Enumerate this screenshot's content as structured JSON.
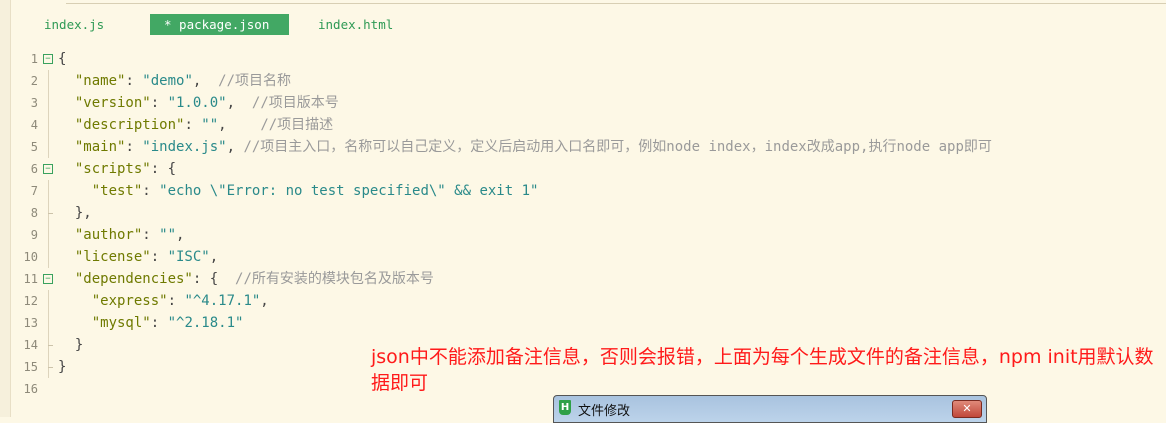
{
  "tabs": [
    {
      "label": "index.js",
      "active": false
    },
    {
      "label": "* package.json",
      "active": true
    },
    {
      "label": "index.html",
      "active": false
    }
  ],
  "lines": [
    {
      "n": "1",
      "fold": "open",
      "tokens": [
        {
          "t": "p",
          "v": "{"
        }
      ]
    },
    {
      "n": "2",
      "tokens": [
        {
          "t": "p",
          "v": "  "
        },
        {
          "t": "k",
          "v": "\"name\""
        },
        {
          "t": "p",
          "v": ": "
        },
        {
          "t": "s",
          "v": "\"demo\""
        },
        {
          "t": "p",
          "v": ",  "
        },
        {
          "t": "c",
          "v": "//项目名称"
        }
      ]
    },
    {
      "n": "3",
      "tokens": [
        {
          "t": "p",
          "v": "  "
        },
        {
          "t": "k",
          "v": "\"version\""
        },
        {
          "t": "p",
          "v": ": "
        },
        {
          "t": "s",
          "v": "\"1.0.0\""
        },
        {
          "t": "p",
          "v": ",  "
        },
        {
          "t": "c",
          "v": "//项目版本号"
        }
      ]
    },
    {
      "n": "4",
      "tokens": [
        {
          "t": "p",
          "v": "  "
        },
        {
          "t": "k",
          "v": "\"description\""
        },
        {
          "t": "p",
          "v": ": "
        },
        {
          "t": "s",
          "v": "\"\""
        },
        {
          "t": "p",
          "v": ",    "
        },
        {
          "t": "c",
          "v": "//项目描述"
        }
      ]
    },
    {
      "n": "5",
      "tokens": [
        {
          "t": "p",
          "v": "  "
        },
        {
          "t": "k",
          "v": "\"main\""
        },
        {
          "t": "p",
          "v": ": "
        },
        {
          "t": "s",
          "v": "\"index.js\""
        },
        {
          "t": "p",
          "v": ", "
        },
        {
          "t": "c",
          "v": "//项目主入口，名称可以自己定义，定义后启动用入口名即可，例如node index，index改成app,执行node app即可"
        }
      ]
    },
    {
      "n": "6",
      "fold": "open",
      "tokens": [
        {
          "t": "p",
          "v": "  "
        },
        {
          "t": "k",
          "v": "\"scripts\""
        },
        {
          "t": "p",
          "v": ": {"
        }
      ]
    },
    {
      "n": "7",
      "tokens": [
        {
          "t": "p",
          "v": "    "
        },
        {
          "t": "k",
          "v": "\"test\""
        },
        {
          "t": "p",
          "v": ": "
        },
        {
          "t": "s",
          "v": "\"echo \\\"Error: no test specified\\\" && exit 1\""
        }
      ]
    },
    {
      "n": "8",
      "end": true,
      "tokens": [
        {
          "t": "p",
          "v": "  },"
        }
      ]
    },
    {
      "n": "9",
      "tokens": [
        {
          "t": "p",
          "v": "  "
        },
        {
          "t": "k",
          "v": "\"author\""
        },
        {
          "t": "p",
          "v": ": "
        },
        {
          "t": "s",
          "v": "\"\""
        },
        {
          "t": "p",
          "v": ","
        }
      ]
    },
    {
      "n": "10",
      "tokens": [
        {
          "t": "p",
          "v": "  "
        },
        {
          "t": "k",
          "v": "\"license\""
        },
        {
          "t": "p",
          "v": ": "
        },
        {
          "t": "s",
          "v": "\"ISC\""
        },
        {
          "t": "p",
          "v": ","
        }
      ]
    },
    {
      "n": "11",
      "fold": "open",
      "tokens": [
        {
          "t": "p",
          "v": "  "
        },
        {
          "t": "k",
          "v": "\"dependencies\""
        },
        {
          "t": "p",
          "v": ": {  "
        },
        {
          "t": "c",
          "v": "//所有安装的模块包名及版本号"
        }
      ]
    },
    {
      "n": "12",
      "tokens": [
        {
          "t": "p",
          "v": "    "
        },
        {
          "t": "k",
          "v": "\"express\""
        },
        {
          "t": "p",
          "v": ": "
        },
        {
          "t": "s",
          "v": "\"^4.17.1\""
        },
        {
          "t": "p",
          "v": ","
        }
      ]
    },
    {
      "n": "13",
      "tokens": [
        {
          "t": "p",
          "v": "    "
        },
        {
          "t": "k",
          "v": "\"mysql\""
        },
        {
          "t": "p",
          "v": ": "
        },
        {
          "t": "s",
          "v": "\"^2.18.1\""
        }
      ]
    },
    {
      "n": "14",
      "end": true,
      "tokens": [
        {
          "t": "p",
          "v": "  }"
        }
      ]
    },
    {
      "n": "15",
      "end": true,
      "tokens": [
        {
          "t": "p",
          "v": "}"
        }
      ]
    },
    {
      "n": "16",
      "tokens": []
    }
  ],
  "annotation": "json中不能添加备注信息，否则会报错，上面为每个生成文件的备注信息，npm init用默认数据即可",
  "dialog": {
    "icon": "H",
    "title": "文件修改",
    "close": "✕"
  },
  "colors": {
    "background": "#fdf8e6",
    "active_tab": "#42a864",
    "key": "#6f7a00",
    "string": "#2a8a8a",
    "comment": "#9a9a9a",
    "annotation": "#ff1a1a"
  }
}
